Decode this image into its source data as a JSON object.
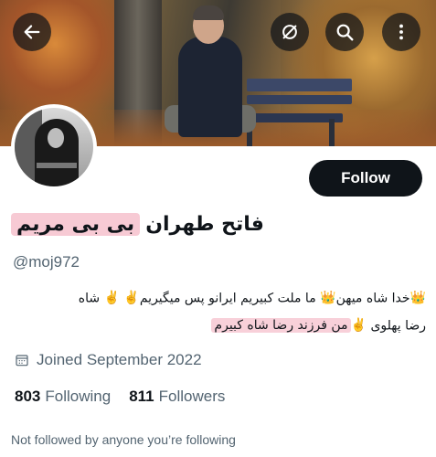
{
  "header": {
    "back_icon": "arrow-left-icon",
    "grok_icon": "grok-icon",
    "search_icon": "search-icon",
    "more_icon": "more-vertical-icon"
  },
  "profile": {
    "follow_label": "Follow",
    "display_name": {
      "highlighted": "بی بی مریم",
      "plain": "فاتح طهران"
    },
    "handle": "@moj972",
    "bio": {
      "line1": "خدا شاه میهن",
      "line1b": "ما ملت کبیریم ایرانو پس میگیریم",
      "line1c": "شاه",
      "line2": "رضا پهلوی",
      "line2_highlight": "من فرزند رضا شاه کبیرم"
    },
    "joined": "Joined September 2022",
    "following_count": "803",
    "following_label": "Following",
    "followers_count": "811",
    "followers_label": "Followers",
    "not_followed": "Not followed by anyone you’re following"
  },
  "colors": {
    "accent_dark": "#0f1419",
    "secondary_text": "#536471",
    "highlight": "#f096aa"
  }
}
